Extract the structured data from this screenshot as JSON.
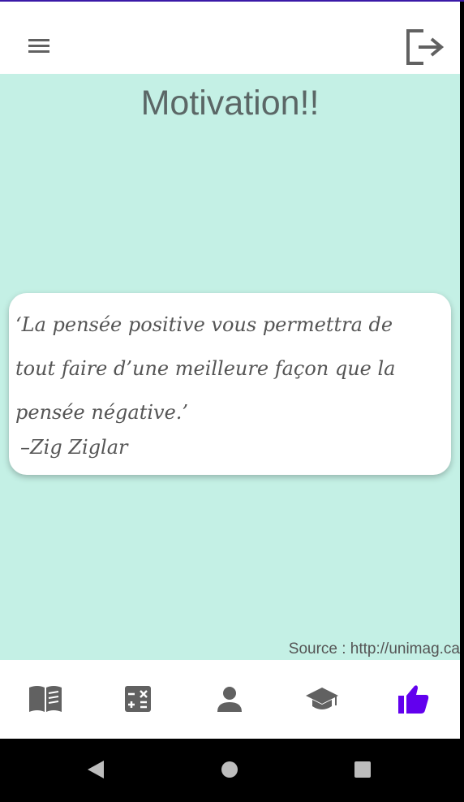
{
  "app": {
    "title": "Motivation!!"
  },
  "quote": {
    "text": "‘La pensée positive vous permettra de tout faire d’une meilleure façon que la pensée négative.’",
    "author": "–Zig Ziglar"
  },
  "source": {
    "text": "Source : http://unimag.ca"
  },
  "colors": {
    "background": "#c4f0e5",
    "accent": "#6200ee",
    "icon_gray": "#616161",
    "title_gray": "#5b6766"
  },
  "icons": {
    "menu": "hamburger-menu-icon",
    "logout": "logout-icon",
    "nav": [
      "book-icon",
      "calculator-icon",
      "person-icon",
      "graduation-cap-icon",
      "thumbs-up-icon"
    ],
    "system": [
      "back-triangle-icon",
      "home-circle-icon",
      "recents-square-icon"
    ]
  },
  "bottom_nav": {
    "active_index": 4
  }
}
